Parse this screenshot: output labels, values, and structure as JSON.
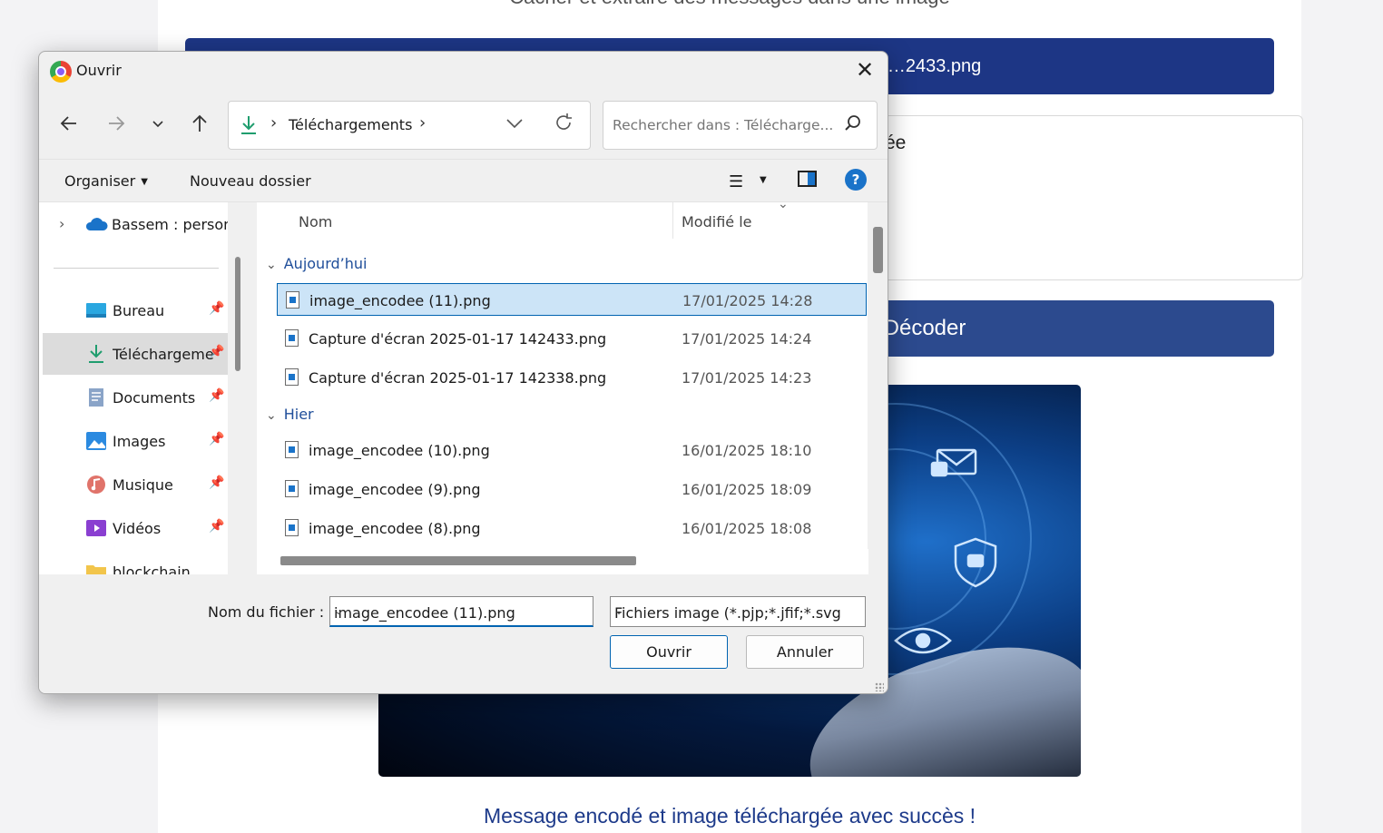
{
  "page": {
    "subtitle": "Cacher et extraire des messages dans une image",
    "file_button_label": "d…2433.png",
    "message_box_label": "ée",
    "decode_button_label": "Décoder",
    "success_message": "Message encodé et image téléchargée avec succès !"
  },
  "dialog": {
    "title": "Ouvrir",
    "breadcrumb": "Téléchargements",
    "search_placeholder": "Rechercher dans : Télécharge...",
    "organize_label": "Organiser",
    "new_folder_label": "Nouveau dossier",
    "sidebar": {
      "cloud_label": "Bassem : person",
      "items": [
        {
          "label": "Bureau",
          "icon": "desktop-icon"
        },
        {
          "label": "Téléchargements",
          "icon": "download-icon"
        },
        {
          "label": "Documents",
          "icon": "documents-icon"
        },
        {
          "label": "Images",
          "icon": "pictures-icon"
        },
        {
          "label": "Musique",
          "icon": "music-icon"
        },
        {
          "label": "Vidéos",
          "icon": "videos-icon"
        },
        {
          "label": "blockchain",
          "icon": "folder-icon"
        }
      ]
    },
    "columns": {
      "name": "Nom",
      "modified": "Modifié le"
    },
    "groups": [
      {
        "label": "Aujourd’hui",
        "files": [
          {
            "name": "image_encodee (11).png",
            "date": "17/01/2025 14:28",
            "selected": true
          },
          {
            "name": "Capture d'écran 2025-01-17 142433.png",
            "date": "17/01/2025 14:24"
          },
          {
            "name": "Capture d'écran 2025-01-17 142338.png",
            "date": "17/01/2025 14:23"
          }
        ]
      },
      {
        "label": "Hier",
        "files": [
          {
            "name": "image_encodee (10).png",
            "date": "16/01/2025 18:10"
          },
          {
            "name": "image_encodee (9).png",
            "date": "16/01/2025 18:09"
          },
          {
            "name": "image_encodee (8).png",
            "date": "16/01/2025 18:08"
          }
        ]
      }
    ],
    "filename_label": "Nom du fichier :",
    "filename_value": "image_encodee (11).png",
    "filetype_value": "Fichiers image (*.pjp;*.jfif;*.svgz",
    "open_button": "Ouvrir",
    "cancel_button": "Annuler"
  },
  "colors": {
    "page_button": "#1d3685",
    "decode_button": "#2c4a8e",
    "selection": "#cce4f7",
    "accent": "#0063b1"
  }
}
